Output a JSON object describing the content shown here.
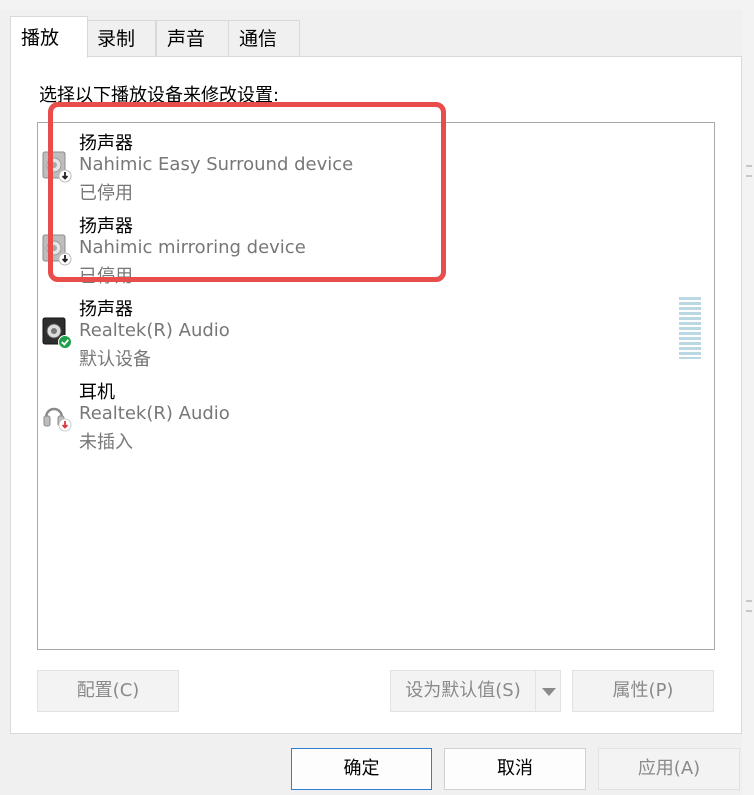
{
  "tabs": [
    {
      "label": "播放",
      "active": true
    },
    {
      "label": "录制",
      "active": false
    },
    {
      "label": "声音",
      "active": false
    },
    {
      "label": "通信",
      "active": false
    }
  ],
  "instruction": "选择以下播放设备来修改设置:",
  "devices": [
    {
      "name": "扬声器",
      "description": "Nahimic Easy Surround device",
      "status": "已停用",
      "icon": "speaker-disabled-icon"
    },
    {
      "name": "扬声器",
      "description": "Nahimic mirroring device",
      "status": "已停用",
      "icon": "speaker-disabled-icon"
    },
    {
      "name": "扬声器",
      "description": "Realtek(R) Audio",
      "status": "默认设备",
      "icon": "speaker-default-icon"
    },
    {
      "name": "耳机",
      "description": "Realtek(R) Audio",
      "status": "未插入",
      "icon": "headphones-unplugged-icon"
    }
  ],
  "buttons": {
    "configure": "配置(C)",
    "set_default": "设为默认值(S)",
    "properties": "属性(P)",
    "ok": "确定",
    "cancel": "取消",
    "apply": "应用(A)"
  },
  "colors": {
    "highlight": "#e84d4a",
    "ok_border": "#2f7fd6",
    "default_check": "#1fa04a",
    "unplugged_x": "#d83a3a"
  }
}
